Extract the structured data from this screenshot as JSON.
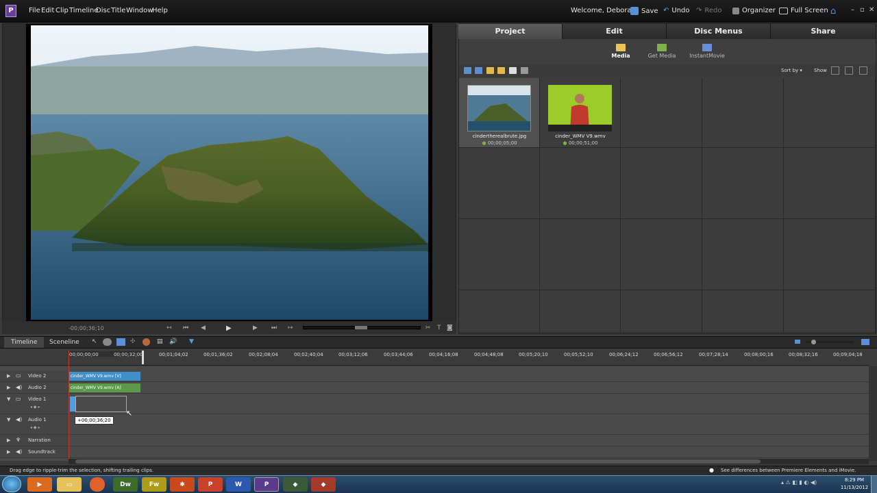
{
  "app": {
    "menus": [
      "File",
      "Edit",
      "Clip",
      "Timeline",
      "Disc",
      "Title",
      "Window",
      "Help"
    ],
    "welcome": "Welcome, Deborah",
    "save": "Save",
    "undo": "Undo",
    "redo": "Redo",
    "organizer": "Organizer",
    "fullscreen": "Full Screen"
  },
  "preview": {
    "timecode": "-00;00;36;10"
  },
  "panel": {
    "tabs": [
      "Project",
      "Edit",
      "Disc Menus",
      "Share"
    ],
    "active_tab": "Project",
    "subtabs": [
      "Media",
      "Get Media",
      "InstantMovie"
    ],
    "active_subtab": "Media",
    "sort_label": "Sort by",
    "show_label": "Show",
    "media": [
      {
        "name": "cindertherealbrute.jpg",
        "duration": "00;00;05;00"
      },
      {
        "name": "cinder_WMV V9.wmv",
        "duration": "00;00;51;00"
      }
    ]
  },
  "timeline": {
    "tabs": [
      "Timeline",
      "Sceneline"
    ],
    "active_tab": "Timeline",
    "ruler": [
      "00;00;00;00",
      "00;00;32;00",
      "00;01;04;02",
      "00;01;36;02",
      "00;02;08;04",
      "00;02;40;04",
      "00;03;12;06",
      "00;03;44;06",
      "00;04;16;08",
      "00;04;48;08",
      "00;05;20;10",
      "00;05;52;10",
      "00;06;24;12",
      "00;06;56;12",
      "00;07;28;14",
      "00;08;00;16",
      "00;08;32;16",
      "00;09;04;18"
    ],
    "tracks": [
      "Video 2",
      "Audio 2",
      "Video 1",
      "Audio 1",
      "Narration",
      "Soundtrack"
    ],
    "clips": {
      "video2": "cinder_WMV V9.wmv [V]",
      "audio2": "cinder_WMV V9.wmv [A]"
    },
    "trim_tooltip": "+00;00;36;20"
  },
  "status": {
    "left": "Drag edge to ripple-trim the selection, shifting trailing clips.",
    "right": "See differences between Premiere Elements and iMovie."
  },
  "taskbar": {
    "time": "8:29 PM",
    "date": "11/13/2012"
  }
}
